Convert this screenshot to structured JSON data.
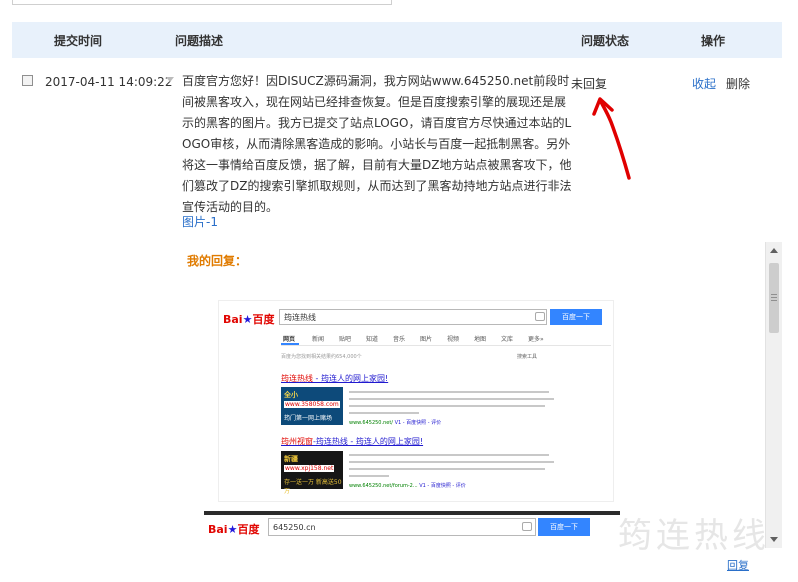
{
  "table": {
    "headers": {
      "time": "提交时间",
      "desc": "问题描述",
      "status": "问题状态",
      "ops": "操作"
    }
  },
  "ticket": {
    "time": "2017-04-11 14:09:22",
    "description": "百度官方您好！因DISUCZ源码漏洞，我方网站www.645250.net前段时间被黑客攻入，现在网站已经排查恢复。但是百度搜索引擎的展现还是展示的黑客的图片。我方已提交了站点LOGO，请百度官方尽快通过本站的LOGO审核，从而清除黑客造成的影响。小站长与百度一起抵制黑客。另外将这一事情给百度反馈，据了解，目前有大量DZ地方站点被黑客攻下，他们篡改了DZ的搜索引擎抓取规则，从而达到了黑客劫持地方站点进行非法宣传活动的目的。",
    "picture_link": "图片-1",
    "status": "未回复",
    "op_collapse": "收起",
    "op_delete": "删除"
  },
  "reply": {
    "label": "我的回复："
  },
  "screenshot1": {
    "logo_bai": "Bai",
    "logo_du": "百度",
    "query": "筠连热线",
    "button": "百度一下",
    "tabs": [
      "网页",
      "新闻",
      "贴吧",
      "知道",
      "音乐",
      "图片",
      "视频",
      "地图",
      "文库",
      "更多»"
    ],
    "result_count": "百度为您找到相关结果约654,000个",
    "tools": "搜索工具",
    "results": [
      {
        "title_red": "筠连热线",
        "title_rest": " - 筠连人的网上家园!",
        "thumb_top": "全小",
        "thumb_mid": "www.358058.com",
        "thumb_bot": "筠门第一网上赌场",
        "url": "www.645250.net/",
        "url_extra": "V1 - 百度快照 - 评价",
        "thumb_bg": "#0d4a7a",
        "thumb_top_color": "#f2d44b"
      },
      {
        "title_red": "筠州视窗",
        "title_rest": "-筠连热线 - 筠连人的网上家园!",
        "thumb_top": "新疆",
        "thumb_mid": "www.xpj158.net",
        "thumb_bot": "存一送一万 新高送50万",
        "url": "www.645250.net/forum-2...",
        "url_extra": "V1 - 百度快照 - 评价",
        "thumb_bg": "#161616",
        "thumb_top_color": "#e8c23a"
      }
    ]
  },
  "screenshot2": {
    "logo_bai": "Bai",
    "logo_du": "百度",
    "query": "645250.cn",
    "button": "百度一下"
  },
  "watermark": "筠连热线",
  "bottom_link": "回复"
}
